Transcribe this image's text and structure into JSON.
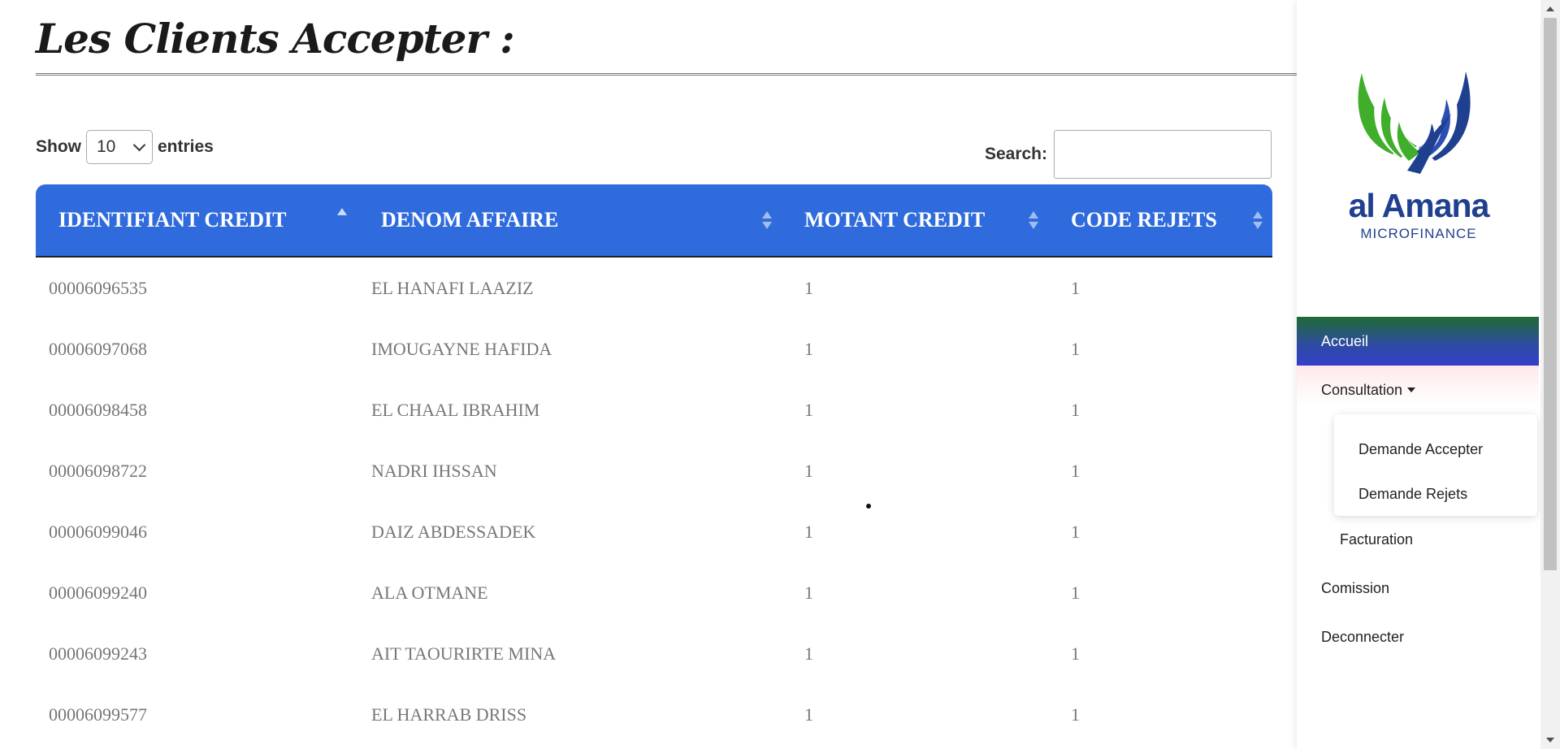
{
  "page": {
    "title": "Les Clients Accepter :"
  },
  "controls": {
    "show_label": "Show",
    "entries_value": "10",
    "entries_label": "entries",
    "search_label": "Search:",
    "search_value": ""
  },
  "table": {
    "headers": [
      "IDENTIFIANT CREDIT",
      "DENOM AFFAIRE",
      "MOTANT CREDIT",
      "CODE REJETS"
    ],
    "sorted_column": "IDENTIFIANT CREDIT",
    "sort_direction": "ascending",
    "rows": [
      [
        "00006096535",
        "EL HANAFI LAAZIZ",
        "1",
        "1"
      ],
      [
        "00006097068",
        "IMOUGAYNE HAFIDA",
        "1",
        "1"
      ],
      [
        "00006098458",
        "EL CHAAL IBRAHIM",
        "1",
        "1"
      ],
      [
        "00006098722",
        "NADRI IHSSAN",
        "1",
        "1"
      ],
      [
        "00006099046",
        "DAIZ ABDESSADEK",
        "1",
        "1"
      ],
      [
        "00006099240",
        "ALA OTMANE",
        "1",
        "1"
      ],
      [
        "00006099243",
        "AIT TAOURIRTE MINA",
        "1",
        "1"
      ],
      [
        "00006099577",
        "EL HARRAB DRISS",
        "1",
        "1"
      ]
    ]
  },
  "sidebar": {
    "logo": {
      "name": "al Amana",
      "sub": "MICROFINANCE",
      "icon": "wings-logo-icon"
    },
    "nav": {
      "accueil": "Accueil",
      "consultation": "Consultation",
      "dropdown": [
        "Demande Accepter",
        "Demande Rejets"
      ],
      "facturation": "Facturation",
      "comission": "Comission",
      "deconnecter": "Deconnecter"
    }
  },
  "colors": {
    "table_header": "#2f6bdc",
    "logo_green": "#3fae2a",
    "logo_blue": "#1f3f8f",
    "nav_active_top": "#1e6b33",
    "nav_active_bottom": "#3440c7"
  }
}
